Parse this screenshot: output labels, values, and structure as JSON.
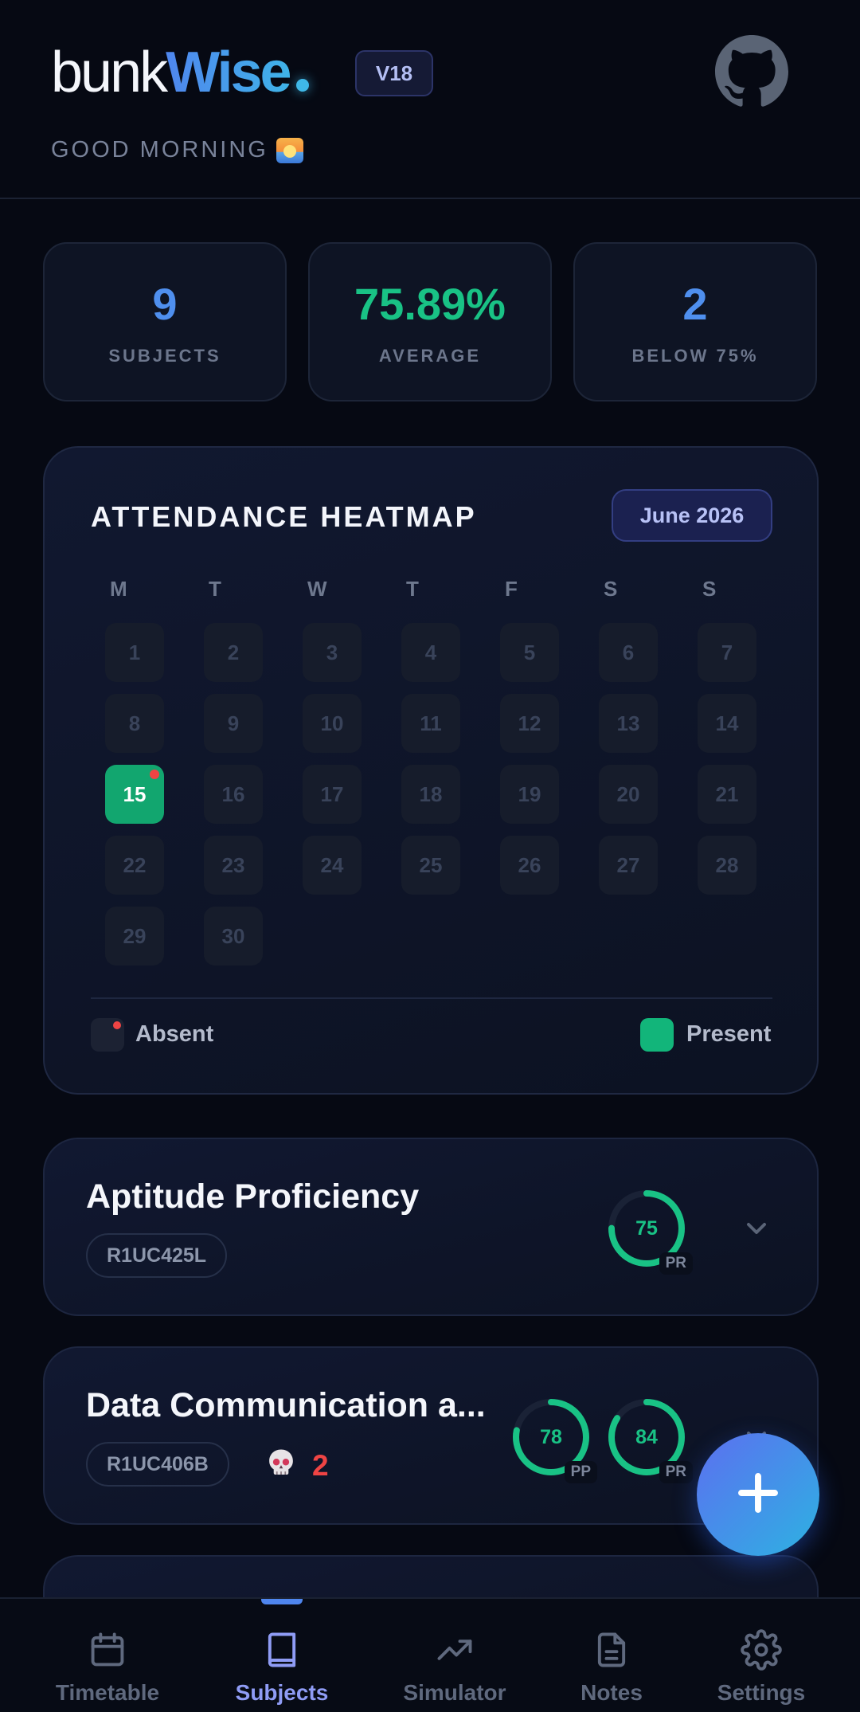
{
  "header": {
    "logo_light": "bunk",
    "logo_bold": "Wise",
    "version": "V18",
    "greeting": "GOOD MORNING"
  },
  "stats": [
    {
      "value": "9",
      "label": "SUBJECTS",
      "color": "#4f8fee"
    },
    {
      "value": "75.89%",
      "label": "AVERAGE",
      "color": "#19c285"
    },
    {
      "value": "2",
      "label": "BELOW 75%",
      "color": "#4f8fee"
    }
  ],
  "heatmap": {
    "title": "ATTENDANCE HEATMAP",
    "month": "June 2026",
    "weekdays": [
      "M",
      "T",
      "W",
      "T",
      "F",
      "S",
      "S"
    ],
    "days": [
      "1",
      "2",
      "3",
      "4",
      "5",
      "6",
      "7",
      "8",
      "9",
      "10",
      "11",
      "12",
      "13",
      "14",
      "15",
      "16",
      "17",
      "18",
      "19",
      "20",
      "21",
      "22",
      "23",
      "24",
      "25",
      "26",
      "27",
      "28",
      "29",
      "30"
    ],
    "present_days": [
      "15"
    ],
    "absent_marked_days": [
      "15"
    ],
    "legend_absent": "Absent",
    "legend_present": "Present"
  },
  "subjects": [
    {
      "name": "Aptitude Proficiency",
      "code": "R1UC425L",
      "rings": [
        {
          "value": "75",
          "tag": "PR",
          "percent": 75
        }
      ]
    },
    {
      "name": "Data Communication a...",
      "code": "R1UC406B",
      "danger_count": "2",
      "rings": [
        {
          "value": "78",
          "tag": "PP",
          "percent": 78
        },
        {
          "value": "84",
          "tag": "PR",
          "percent": 84
        }
      ]
    }
  ],
  "nav": {
    "items": [
      {
        "label": "Timetable",
        "icon": "calendar-icon"
      },
      {
        "label": "Subjects",
        "icon": "book-icon"
      },
      {
        "label": "Simulator",
        "icon": "trending-up-icon"
      },
      {
        "label": "Notes",
        "icon": "document-icon"
      },
      {
        "label": "Settings",
        "icon": "gear-icon"
      }
    ],
    "active": "Subjects"
  },
  "colors": {
    "accent": "#4f86ee",
    "present": "#12a66f",
    "absent": "#ef4444",
    "ring": "#19c285"
  }
}
